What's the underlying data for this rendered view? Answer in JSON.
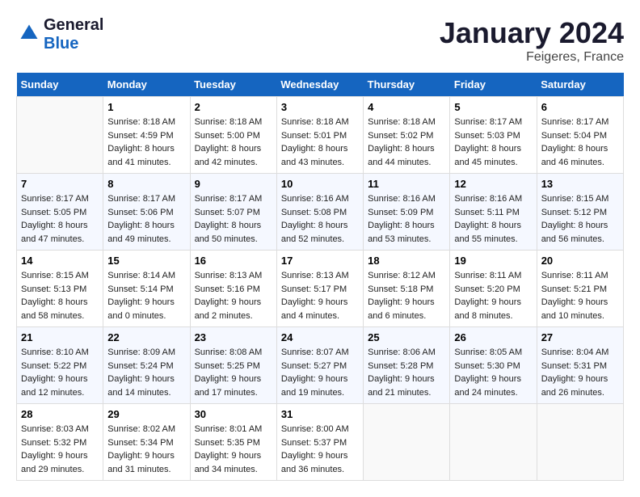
{
  "logo": {
    "line1": "General",
    "line2": "Blue"
  },
  "title": "January 2024",
  "location": "Feigeres, France",
  "days_of_week": [
    "Sunday",
    "Monday",
    "Tuesday",
    "Wednesday",
    "Thursday",
    "Friday",
    "Saturday"
  ],
  "weeks": [
    [
      {
        "num": "",
        "info": ""
      },
      {
        "num": "1",
        "info": "Sunrise: 8:18 AM\nSunset: 4:59 PM\nDaylight: 8 hours\nand 41 minutes."
      },
      {
        "num": "2",
        "info": "Sunrise: 8:18 AM\nSunset: 5:00 PM\nDaylight: 8 hours\nand 42 minutes."
      },
      {
        "num": "3",
        "info": "Sunrise: 8:18 AM\nSunset: 5:01 PM\nDaylight: 8 hours\nand 43 minutes."
      },
      {
        "num": "4",
        "info": "Sunrise: 8:18 AM\nSunset: 5:02 PM\nDaylight: 8 hours\nand 44 minutes."
      },
      {
        "num": "5",
        "info": "Sunrise: 8:17 AM\nSunset: 5:03 PM\nDaylight: 8 hours\nand 45 minutes."
      },
      {
        "num": "6",
        "info": "Sunrise: 8:17 AM\nSunset: 5:04 PM\nDaylight: 8 hours\nand 46 minutes."
      }
    ],
    [
      {
        "num": "7",
        "info": "Sunrise: 8:17 AM\nSunset: 5:05 PM\nDaylight: 8 hours\nand 47 minutes."
      },
      {
        "num": "8",
        "info": "Sunrise: 8:17 AM\nSunset: 5:06 PM\nDaylight: 8 hours\nand 49 minutes."
      },
      {
        "num": "9",
        "info": "Sunrise: 8:17 AM\nSunset: 5:07 PM\nDaylight: 8 hours\nand 50 minutes."
      },
      {
        "num": "10",
        "info": "Sunrise: 8:16 AM\nSunset: 5:08 PM\nDaylight: 8 hours\nand 52 minutes."
      },
      {
        "num": "11",
        "info": "Sunrise: 8:16 AM\nSunset: 5:09 PM\nDaylight: 8 hours\nand 53 minutes."
      },
      {
        "num": "12",
        "info": "Sunrise: 8:16 AM\nSunset: 5:11 PM\nDaylight: 8 hours\nand 55 minutes."
      },
      {
        "num": "13",
        "info": "Sunrise: 8:15 AM\nSunset: 5:12 PM\nDaylight: 8 hours\nand 56 minutes."
      }
    ],
    [
      {
        "num": "14",
        "info": "Sunrise: 8:15 AM\nSunset: 5:13 PM\nDaylight: 8 hours\nand 58 minutes."
      },
      {
        "num": "15",
        "info": "Sunrise: 8:14 AM\nSunset: 5:14 PM\nDaylight: 9 hours\nand 0 minutes."
      },
      {
        "num": "16",
        "info": "Sunrise: 8:13 AM\nSunset: 5:16 PM\nDaylight: 9 hours\nand 2 minutes."
      },
      {
        "num": "17",
        "info": "Sunrise: 8:13 AM\nSunset: 5:17 PM\nDaylight: 9 hours\nand 4 minutes."
      },
      {
        "num": "18",
        "info": "Sunrise: 8:12 AM\nSunset: 5:18 PM\nDaylight: 9 hours\nand 6 minutes."
      },
      {
        "num": "19",
        "info": "Sunrise: 8:11 AM\nSunset: 5:20 PM\nDaylight: 9 hours\nand 8 minutes."
      },
      {
        "num": "20",
        "info": "Sunrise: 8:11 AM\nSunset: 5:21 PM\nDaylight: 9 hours\nand 10 minutes."
      }
    ],
    [
      {
        "num": "21",
        "info": "Sunrise: 8:10 AM\nSunset: 5:22 PM\nDaylight: 9 hours\nand 12 minutes."
      },
      {
        "num": "22",
        "info": "Sunrise: 8:09 AM\nSunset: 5:24 PM\nDaylight: 9 hours\nand 14 minutes."
      },
      {
        "num": "23",
        "info": "Sunrise: 8:08 AM\nSunset: 5:25 PM\nDaylight: 9 hours\nand 17 minutes."
      },
      {
        "num": "24",
        "info": "Sunrise: 8:07 AM\nSunset: 5:27 PM\nDaylight: 9 hours\nand 19 minutes."
      },
      {
        "num": "25",
        "info": "Sunrise: 8:06 AM\nSunset: 5:28 PM\nDaylight: 9 hours\nand 21 minutes."
      },
      {
        "num": "26",
        "info": "Sunrise: 8:05 AM\nSunset: 5:30 PM\nDaylight: 9 hours\nand 24 minutes."
      },
      {
        "num": "27",
        "info": "Sunrise: 8:04 AM\nSunset: 5:31 PM\nDaylight: 9 hours\nand 26 minutes."
      }
    ],
    [
      {
        "num": "28",
        "info": "Sunrise: 8:03 AM\nSunset: 5:32 PM\nDaylight: 9 hours\nand 29 minutes."
      },
      {
        "num": "29",
        "info": "Sunrise: 8:02 AM\nSunset: 5:34 PM\nDaylight: 9 hours\nand 31 minutes."
      },
      {
        "num": "30",
        "info": "Sunrise: 8:01 AM\nSunset: 5:35 PM\nDaylight: 9 hours\nand 34 minutes."
      },
      {
        "num": "31",
        "info": "Sunrise: 8:00 AM\nSunset: 5:37 PM\nDaylight: 9 hours\nand 36 minutes."
      },
      {
        "num": "",
        "info": ""
      },
      {
        "num": "",
        "info": ""
      },
      {
        "num": "",
        "info": ""
      }
    ]
  ]
}
